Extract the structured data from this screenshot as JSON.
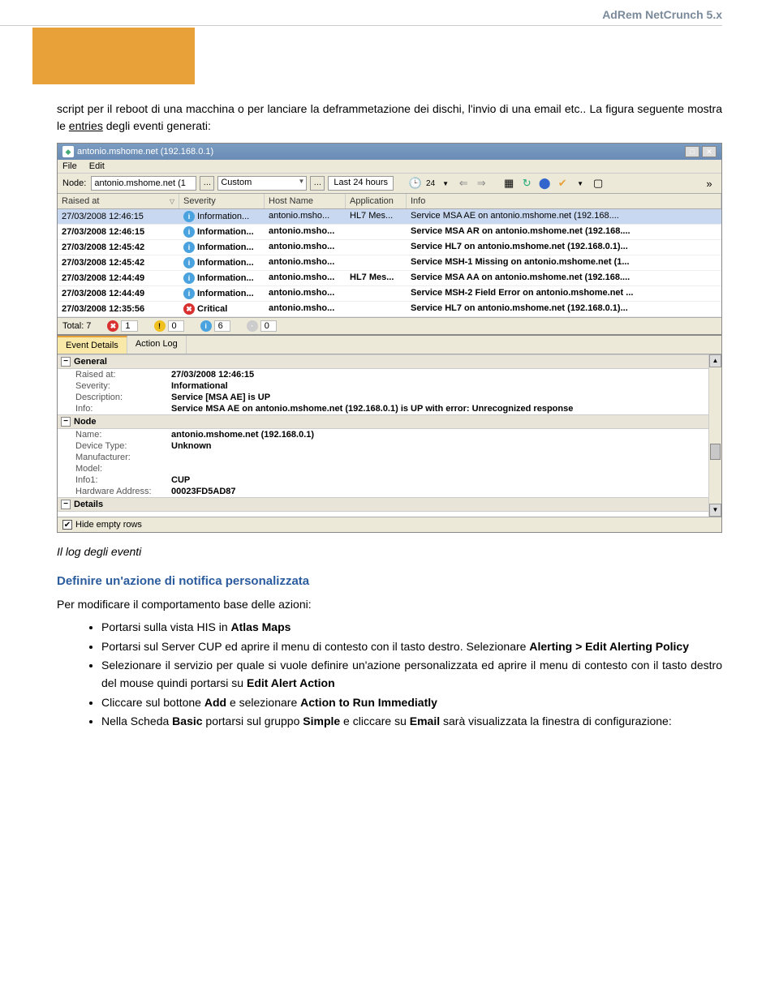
{
  "header": {
    "title": "AdRem NetCrunch 5.x"
  },
  "para1_pre": "script per il reboot di una macchina o per lanciare la deframmetazione dei dischi, l'invio di una email etc.. La figura seguente mostra le ",
  "para1_u": "entries",
  "para1_post": " degli eventi generati:",
  "window": {
    "title": "antonio.mshome.net (192.168.0.1)",
    "menu": {
      "file": "File",
      "edit": "Edit"
    },
    "toolbar": {
      "node_label": "Node:",
      "node_value": "antonio.mshome.net (1",
      "custom": "Custom",
      "last24": "Last 24 hours",
      "clock": "24",
      "more": "»"
    },
    "grid": {
      "cols": {
        "raised": "Raised at",
        "severity": "Severity",
        "host": "Host Name",
        "app": "Application",
        "info": "Info"
      },
      "rows": [
        {
          "raised": "27/03/2008 12:46:15",
          "sev": "Information...",
          "sevtype": "info",
          "host": "antonio.msho...",
          "app": "HL7 Mes...",
          "info": "Service MSA AE on antonio.mshome.net (192.168....",
          "selected": true
        },
        {
          "raised": "27/03/2008 12:46:15",
          "sev": "Information...",
          "sevtype": "info",
          "host": "antonio.msho...",
          "app": "",
          "info": "Service MSA AR on antonio.mshome.net (192.168...."
        },
        {
          "raised": "27/03/2008 12:45:42",
          "sev": "Information...",
          "sevtype": "info",
          "host": "antonio.msho...",
          "app": "",
          "info": "Service HL7 on antonio.mshome.net (192.168.0.1)..."
        },
        {
          "raised": "27/03/2008 12:45:42",
          "sev": "Information...",
          "sevtype": "info",
          "host": "antonio.msho...",
          "app": "",
          "info": "Service MSH-1 Missing on antonio.mshome.net (1..."
        },
        {
          "raised": "27/03/2008 12:44:49",
          "sev": "Information...",
          "sevtype": "info",
          "host": "antonio.msho...",
          "app": "HL7 Mes...",
          "info": "Service MSA AA on antonio.mshome.net (192.168...."
        },
        {
          "raised": "27/03/2008 12:44:49",
          "sev": "Information...",
          "sevtype": "info",
          "host": "antonio.msho...",
          "app": "",
          "info": "Service MSH-2 Field Error on antonio.mshome.net ..."
        },
        {
          "raised": "27/03/2008 12:35:56",
          "sev": "Critical",
          "sevtype": "crit",
          "host": "antonio.msho...",
          "app": "",
          "info": "Service HL7 on antonio.mshome.net (192.168.0.1)..."
        }
      ]
    },
    "status": {
      "total_label": "Total:",
      "total": "7",
      "crit": "1",
      "warn": "0",
      "info": "6",
      "other": "0"
    },
    "details": {
      "tabs": {
        "event_details": "Event Details",
        "action_log": "Action Log"
      },
      "general": {
        "title": "General",
        "raised_label": "Raised at:",
        "raised": "27/03/2008 12:46:15",
        "severity_label": "Severity:",
        "severity": "Informational",
        "desc_label": "Description:",
        "desc": "Service [MSA AE] is UP",
        "info_label": "Info:",
        "info": "Service MSA AE on antonio.mshome.net (192.168.0.1) is UP with error: Unrecognized response"
      },
      "node": {
        "title": "Node",
        "name_label": "Name:",
        "name": "antonio.mshome.net (192.168.0.1)",
        "device_label": "Device Type:",
        "device": "Unknown",
        "manuf_label": "Manufacturer:",
        "manuf": "",
        "model_label": "Model:",
        "model": "",
        "info1_label": "Info1:",
        "info1": "CUP",
        "hw_label": "Hardware Address:",
        "hw": "00023FD5AD87"
      },
      "details_section": {
        "title": "Details"
      },
      "hide_empty": "Hide empty rows"
    }
  },
  "caption": "Il log degli eventi",
  "heading": "Definire un'azione di notifica personalizzata",
  "intro": "Per modificare il comportamento base delle azioni:",
  "bullets": {
    "b1_pre": "Portarsi sulla vista HIS in ",
    "b1_bold": "Atlas Maps",
    "b2": "Portarsi sul Server CUP ed aprire il menu di contesto con il tasto destro. Selezionare ",
    "b2_bold": "Alerting > Edit Alerting Policy",
    "b3_pre": "Selezionare il servizio per quale si vuole definire un'azione personalizzata ed aprire il menu di contesto con il tasto destro del mouse quindi portarsi su ",
    "b3_bold": "Edit Alert Action",
    "b4_pre": "Cliccare sul bottone ",
    "b4_b1": "Add",
    "b4_mid": " e selezionare ",
    "b4_b2": "Action to Run Immediatly",
    "b5_pre": "Nella Scheda ",
    "b5_b1": "Basic",
    "b5_mid1": " portarsi sul gruppo ",
    "b5_b2": "Simple",
    "b5_mid2": " e cliccare su ",
    "b5_b3": "Email",
    "b5_post": " sarà visualizzata la finestra di configurazione:"
  }
}
